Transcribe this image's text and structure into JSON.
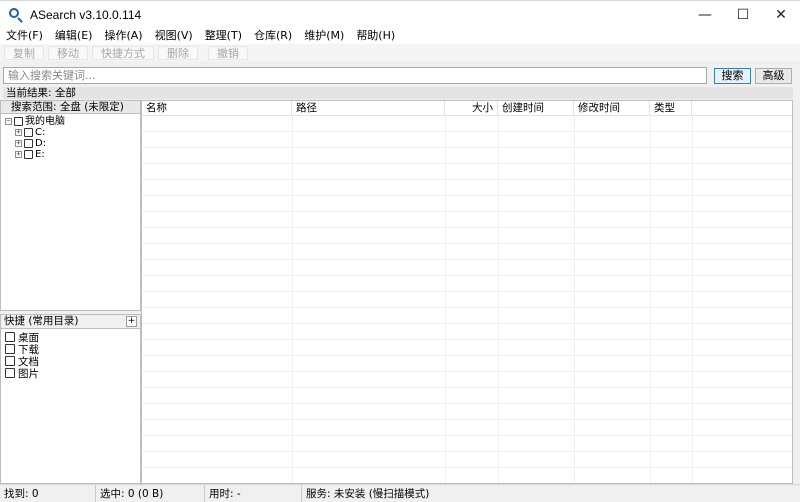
{
  "window": {
    "title": "ASearch v3.10.0.114",
    "minimize": "—",
    "maximize": "☐",
    "close": "✕"
  },
  "menu": [
    "文件(F)",
    "编辑(E)",
    "操作(A)",
    "视图(V)",
    "整理(T)",
    "仓库(R)",
    "维护(M)",
    "帮助(H)"
  ],
  "toolbar": [
    "复制",
    "移动",
    "快捷方式",
    "删除",
    "撤销"
  ],
  "search": {
    "placeholder": "输入搜索关键词...",
    "value": "",
    "search_label": "搜索",
    "advanced_label": "高级"
  },
  "result_info": "当前结果: 全部",
  "scope": {
    "header": "搜索范围: 全盘 (未限定)",
    "root": "我的电脑",
    "drives": [
      "C:",
      "D:",
      "E:"
    ]
  },
  "quick": {
    "header": "快捷 (常用目录)",
    "add": "+",
    "items": [
      "桌面",
      "下载",
      "文档",
      "图片"
    ]
  },
  "table": {
    "columns": [
      "名称",
      "路径",
      "大小",
      "创建时间",
      "修改时间",
      "类型"
    ]
  },
  "status": {
    "found": "找到: 0",
    "selected": "选中: 0 (0 B)",
    "elapsed": "用时: -",
    "service": "服务: 未安装 (慢扫描模式)"
  },
  "colors": {
    "accent": "#1d5fa8",
    "disabled_text": "#a6a6a6"
  }
}
